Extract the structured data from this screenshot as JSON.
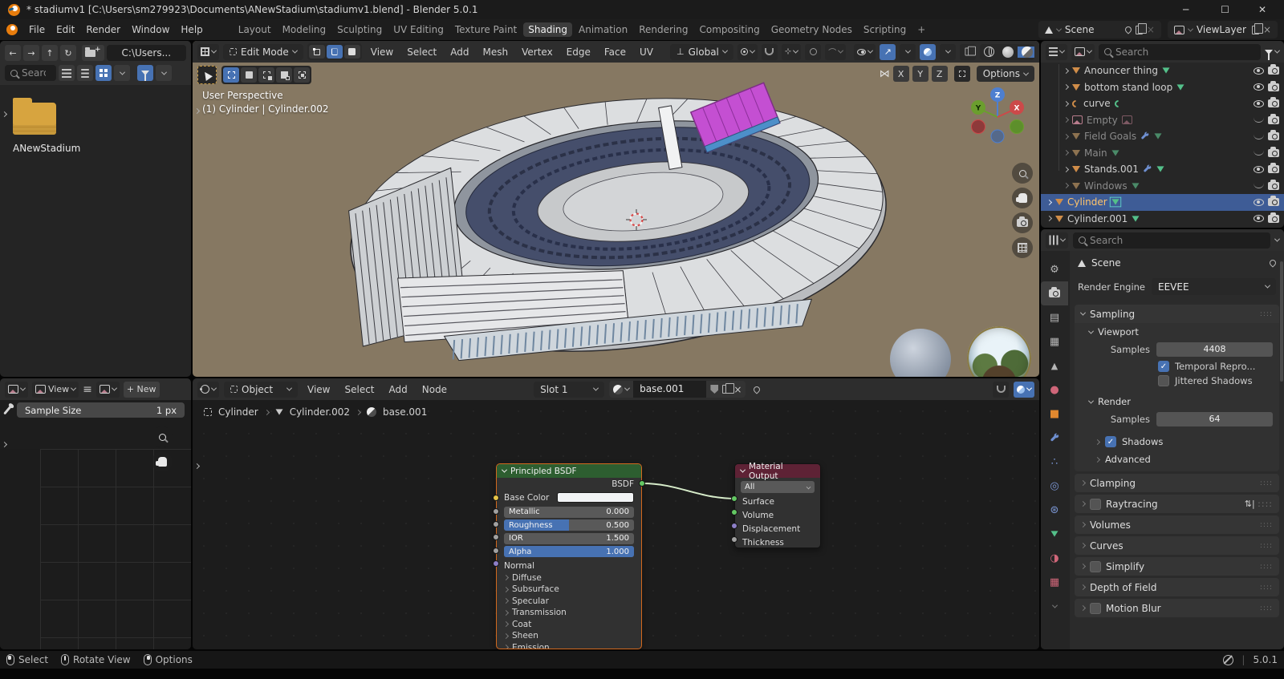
{
  "colors": {
    "accent_blue": "#4772b3",
    "blender_orange": "#e87d0d",
    "outliner_selection": "#3e5c96",
    "active_object_text": "#ffc46b",
    "viewport_background": "#867862",
    "node_header_green": "#2d5e30",
    "node_header_maroon": "#5e2235",
    "selected_faces_magenta": "#c44fd2"
  },
  "titlebar": {
    "title": "* stadiumv1 [C:\\Users\\sm279923\\Documents\\ANewStadium\\stadiumv1.blend] - Blender 5.0.1",
    "minimize": "─",
    "maximize": "☐",
    "close": "✕"
  },
  "topbar": {
    "menus": [
      "File",
      "Edit",
      "Render",
      "Window",
      "Help"
    ],
    "tabs": [
      "Layout",
      "Modeling",
      "Sculpting",
      "UV Editing",
      "Texture Paint",
      "Shading",
      "Animation",
      "Rendering",
      "Compositing",
      "Geometry Nodes",
      "Scripting"
    ],
    "active_tab": "Shading",
    "add_tab": "+",
    "scene_label": "Scene",
    "view_layer_label": "ViewLayer"
  },
  "file_browser": {
    "path": "C:\\Users...",
    "search_placeholder": "Search",
    "folder_name": "ANewStadium"
  },
  "image_editor": {
    "view_menu": "View",
    "new_button": "+ New",
    "sample_size_label": "Sample Size",
    "sample_size_value": "1 px"
  },
  "viewport": {
    "mode": "Edit Mode",
    "menus": [
      "View",
      "Select",
      "Add",
      "Mesh",
      "Vertex",
      "Edge",
      "Face",
      "UV"
    ],
    "orientation": "Global",
    "mirror_axes": [
      "X",
      "Y",
      "Z"
    ],
    "options_label": "Options",
    "overlay_line1": "User Perspective",
    "overlay_line2": "(1) Cylinder | Cylinder.002",
    "gizmo": {
      "x": "X",
      "y": "Y",
      "z": "Z"
    }
  },
  "shader_editor": {
    "mode": "Object",
    "menus": [
      "View",
      "Select",
      "Add",
      "Node"
    ],
    "slot": "Slot 1",
    "material_name": "base.001",
    "breadcrumb": [
      "Cylinder",
      "Cylinder.002",
      "base.001"
    ],
    "principled": {
      "title": "Principled BSDF",
      "output_socket": "BSDF",
      "base_color_label": "Base Color",
      "rows": [
        {
          "label": "Metallic",
          "value": "0.000"
        },
        {
          "label": "Roughness",
          "value": "0.500"
        },
        {
          "label": "IOR",
          "value": "1.500"
        },
        {
          "label": "Alpha",
          "value": "1.000"
        }
      ],
      "normal_label": "Normal",
      "collapsed_sections": [
        "Diffuse",
        "Subsurface",
        "Specular",
        "Transmission",
        "Coat",
        "Sheen",
        "Emission"
      ]
    },
    "material_output": {
      "title": "Material Output",
      "target": "All",
      "inputs": [
        "Surface",
        "Volume",
        "Displacement",
        "Thickness"
      ]
    }
  },
  "outliner": {
    "search_placeholder": "Search",
    "rows": [
      {
        "label": "Anouncer thing",
        "type": "mesh",
        "visible": true
      },
      {
        "label": "bottom stand loop",
        "type": "mesh",
        "visible": true
      },
      {
        "label": "curve",
        "type": "curve",
        "visible": true
      },
      {
        "label": "Empty",
        "type": "empty",
        "visible": false
      },
      {
        "label": "Field Goals",
        "type": "mesh",
        "visible": false,
        "has_modifier": true
      },
      {
        "label": "Main",
        "type": "mesh",
        "visible": false
      },
      {
        "label": "Stands.001",
        "type": "mesh",
        "visible": true,
        "has_modifier": true
      },
      {
        "label": "Windows",
        "type": "mesh",
        "visible": false
      },
      {
        "label": "Cylinder",
        "type": "mesh",
        "visible": true,
        "selected": true
      },
      {
        "label": "Cylinder.001",
        "type": "mesh",
        "visible": true
      }
    ]
  },
  "properties": {
    "search_placeholder": "Search",
    "scene_breadcrumb": "Scene",
    "render_engine_label": "Render Engine",
    "render_engine_value": "EEVEE",
    "sampling_title": "Sampling",
    "viewport_subtitle": "Viewport",
    "samples_label": "Samples",
    "viewport_samples": "4408",
    "temporal_label": "Temporal Repro...",
    "jittered_label": "Jittered Shadows",
    "render_subtitle": "Render",
    "render_samples_label": "Samples",
    "render_samples": "64",
    "shadows_label": "Shadows",
    "advanced_label": "Advanced",
    "panels": [
      "Clamping",
      "Raytracing",
      "Volumes",
      "Curves",
      "Simplify",
      "Depth of Field",
      "Motion Blur"
    ]
  },
  "statusbar": {
    "left_items": [
      "Select",
      "Rotate View",
      "Options"
    ],
    "version": "5.0.1"
  }
}
